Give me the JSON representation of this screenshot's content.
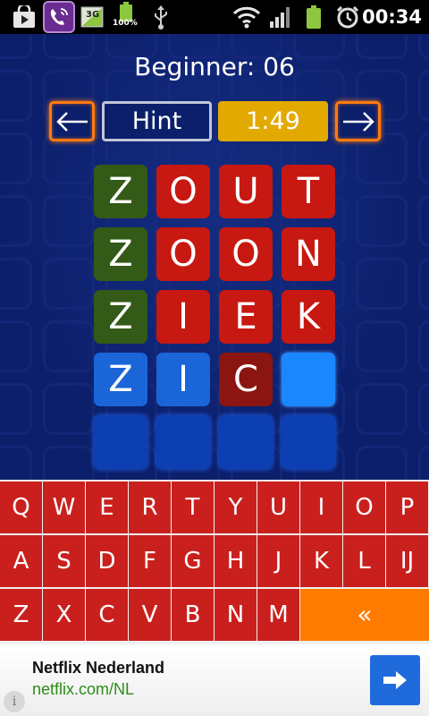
{
  "status_bar": {
    "icons": [
      "store-bag-icon",
      "phone-call-icon",
      "3g-signal-icon",
      "battery-small-icon",
      "usb-icon",
      "wifi-icon",
      "cell-signal-icon",
      "battery-icon",
      "alarm-icon"
    ],
    "network_label": "3G",
    "battery_percent": "100%",
    "time": "00:34"
  },
  "game": {
    "title": "Beginner: 06",
    "prev_icon": "arrow-left-icon",
    "next_icon": "arrow-right-icon",
    "hint_label": "Hint",
    "timer": "1:49",
    "rows": [
      [
        {
          "letter": "Z",
          "state": "green"
        },
        {
          "letter": "O",
          "state": "red"
        },
        {
          "letter": "U",
          "state": "red"
        },
        {
          "letter": "T",
          "state": "red"
        }
      ],
      [
        {
          "letter": "Z",
          "state": "green"
        },
        {
          "letter": "O",
          "state": "red"
        },
        {
          "letter": "O",
          "state": "red"
        },
        {
          "letter": "N",
          "state": "red"
        }
      ],
      [
        {
          "letter": "Z",
          "state": "green"
        },
        {
          "letter": "I",
          "state": "red"
        },
        {
          "letter": "E",
          "state": "red"
        },
        {
          "letter": "K",
          "state": "red"
        }
      ],
      [
        {
          "letter": "Z",
          "state": "blue"
        },
        {
          "letter": "I",
          "state": "blue"
        },
        {
          "letter": "C",
          "state": "dark-red"
        },
        {
          "letter": "",
          "state": "cursor"
        }
      ],
      [
        {
          "letter": "",
          "state": "empty"
        },
        {
          "letter": "",
          "state": "empty"
        },
        {
          "letter": "",
          "state": "empty"
        },
        {
          "letter": "",
          "state": "empty"
        }
      ]
    ],
    "colors": {
      "correct": "#335a17",
      "wrong": "#c71812",
      "entered": "#1a66d8",
      "hinted": "#8b1510",
      "cursor": "#1b87ff",
      "empty": "#0b3fb2",
      "accent": "#ff7a10",
      "timer": "#e2a900"
    }
  },
  "keyboard": {
    "row1": [
      "Q",
      "W",
      "E",
      "R",
      "T",
      "Y",
      "U",
      "I",
      "O",
      "P"
    ],
    "row2": [
      "A",
      "S",
      "D",
      "F",
      "G",
      "H",
      "J",
      "K",
      "L",
      "IJ"
    ],
    "row3": [
      "Z",
      "X",
      "C",
      "V",
      "B",
      "N",
      "M"
    ],
    "backspace": "«",
    "key_color": "#c9201e",
    "backspace_color": "#ff7b00"
  },
  "ad": {
    "title": "Netflix Nederland",
    "url": "netflix.com/NL",
    "arrow_icon": "arrow-right-icon",
    "info_icon": "info-icon",
    "info_glyph": "i"
  }
}
